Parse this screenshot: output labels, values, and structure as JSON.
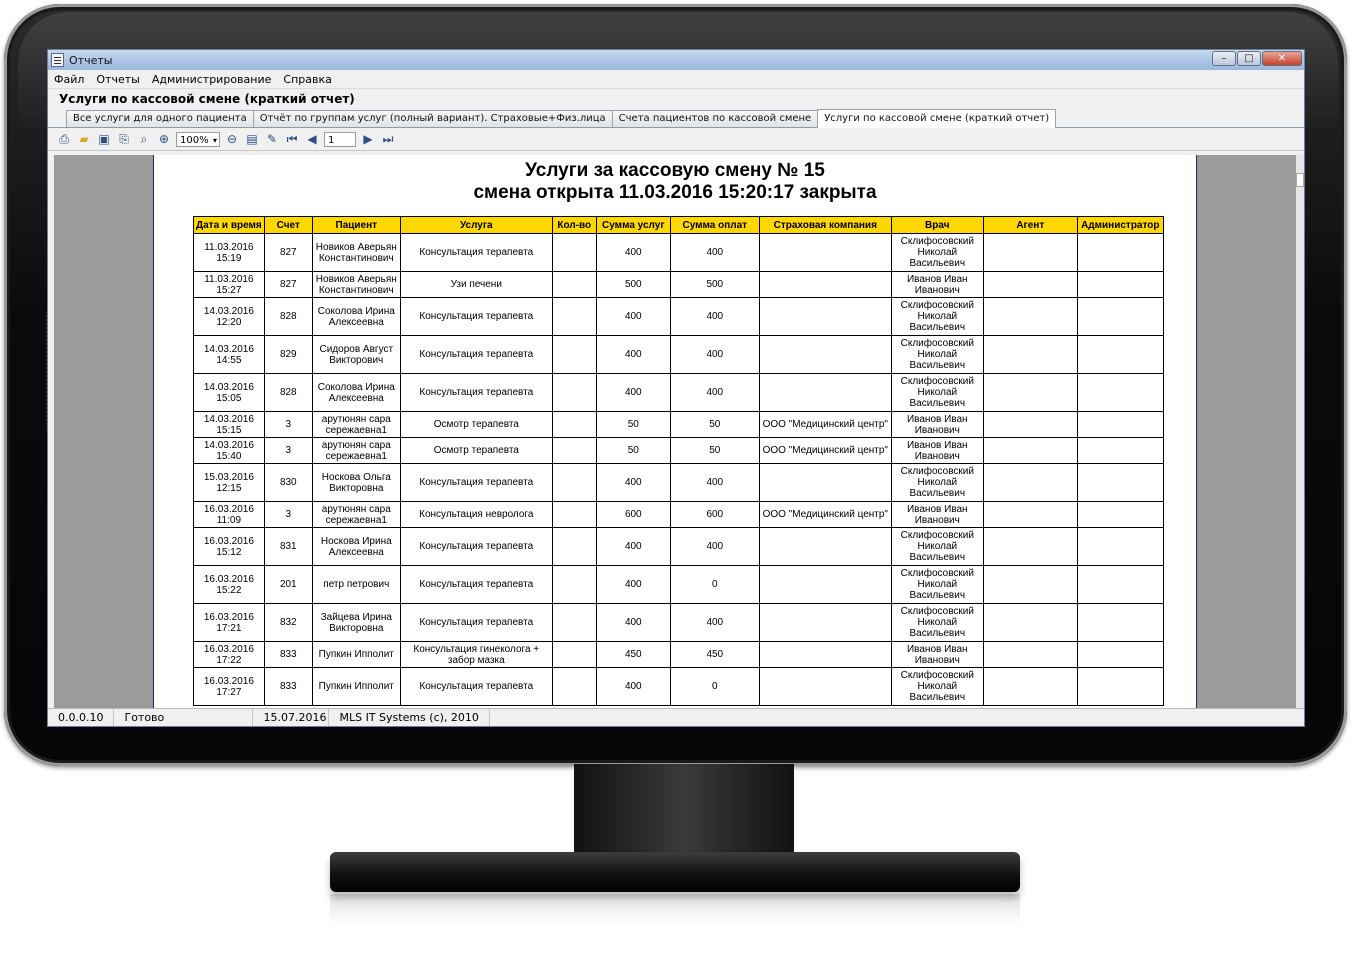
{
  "window": {
    "title": "Отчеты",
    "minimize": "–",
    "maximize": "□",
    "close": "✕"
  },
  "menu": [
    "Файл",
    "Отчеты",
    "Администрирование",
    "Справка"
  ],
  "report_title": "Услуги по кассовой смене  (краткий отчет)",
  "tabs": [
    "Все услуги для одного пациента",
    "Отчёт по группам услуг (полный вариант). Страховые+Физ.лица",
    "Счета пациентов по кассовой смене",
    "Услуги по кассовой смене  (краткий отчет)"
  ],
  "active_tab": 3,
  "toolbar": {
    "zoom": "100%",
    "page": "1"
  },
  "document": {
    "title_line1": "Услуги за кассовую смену № 15",
    "title_line2": "смена открыта 11.03.2016 15:20:17 закрыта"
  },
  "table": {
    "columns": [
      "Дата и время",
      "Счет",
      "Пациент",
      "Услуга",
      "Кол-во",
      "Сумма услуг",
      "Сумма оплат",
      "Страховая компания",
      "Врач",
      "Агент",
      "Администратор"
    ],
    "rows": [
      [
        "11.03.2016 15:19",
        "827",
        "Новиков Аверьян Константинович",
        "Консультация терапевта",
        "",
        "400",
        "400",
        "",
        "Склифосовский Николай Васильевич",
        "",
        ""
      ],
      [
        "11.03.2016 15:27",
        "827",
        "Новиков Аверьян Константинович",
        "Узи печени",
        "",
        "500",
        "500",
        "",
        "Иванов Иван Иванович",
        "",
        ""
      ],
      [
        "14.03.2016 12:20",
        "828",
        "Соколова Ирина Алексеевна",
        "Консультация терапевта",
        "",
        "400",
        "400",
        "",
        "Склифосовский Николай Васильевич",
        "",
        ""
      ],
      [
        "14.03.2016 14:55",
        "829",
        "Сидоров Август Викторович",
        "Консультация терапевта",
        "",
        "400",
        "400",
        "",
        "Склифосовский Николай Васильевич",
        "",
        ""
      ],
      [
        "14.03.2016 15:05",
        "828",
        "Соколова Ирина Алексеевна",
        "Консультация терапевта",
        "",
        "400",
        "400",
        "",
        "Склифосовский Николай Васильевич",
        "",
        ""
      ],
      [
        "14.03.2016 15:15",
        "3",
        "арутюнян сара сережаевна1",
        "Осмотр терапевта",
        "",
        "50",
        "50",
        "ООО \"Медицинский центр\"",
        "Иванов Иван Иванович",
        "",
        ""
      ],
      [
        "14.03.2016 15:40",
        "3",
        "арутюнян сара сережаевна1",
        "Осмотр терапевта",
        "",
        "50",
        "50",
        "ООО \"Медицинский центр\"",
        "Иванов Иван Иванович",
        "",
        ""
      ],
      [
        "15.03.2016 12:15",
        "830",
        "Носкова Ольга Викторовна",
        "Консультация терапевта",
        "",
        "400",
        "400",
        "",
        "Склифосовский Николай Васильевич",
        "",
        ""
      ],
      [
        "16.03.2016 11:09",
        "3",
        "арутюнян сара сережаевна1",
        "Консультация невролога",
        "",
        "600",
        "600",
        "ООО \"Медицинский центр\"",
        "Иванов Иван Иванович",
        "",
        ""
      ],
      [
        "16.03.2016 15:12",
        "831",
        "Носкова Ирина Алексеевна",
        "Консультация терапевта",
        "",
        "400",
        "400",
        "",
        "Склифосовский Николай Васильевич",
        "",
        ""
      ],
      [
        "16.03.2016 15:22",
        "201",
        "петр петрович",
        "Консультация терапевта",
        "",
        "400",
        "0",
        "",
        "Склифосовский Николай Васильевич",
        "",
        ""
      ],
      [
        "16.03.2016 17:21",
        "832",
        "Зайцева Ирина Викторовна",
        "Консультация терапевта",
        "",
        "400",
        "400",
        "",
        "Склифосовский Николай Васильевич",
        "",
        ""
      ],
      [
        "16.03.2016 17:22",
        "833",
        "Пупкин Ипполит",
        "Консультация гинеколога + забор мазка",
        "",
        "450",
        "450",
        "",
        "Иванов Иван Иванович",
        "",
        ""
      ],
      [
        "16.03.2016 17:27",
        "833",
        "Пупкин Ипполит",
        "Консультация терапевта",
        "",
        "400",
        "0",
        "",
        "Склифосовский Николай Васильевич",
        "",
        ""
      ]
    ]
  },
  "statusbar": [
    "0.0.0.10",
    "Готово",
    "15.07.2016",
    "MLS IT Systems (c), 2010"
  ]
}
